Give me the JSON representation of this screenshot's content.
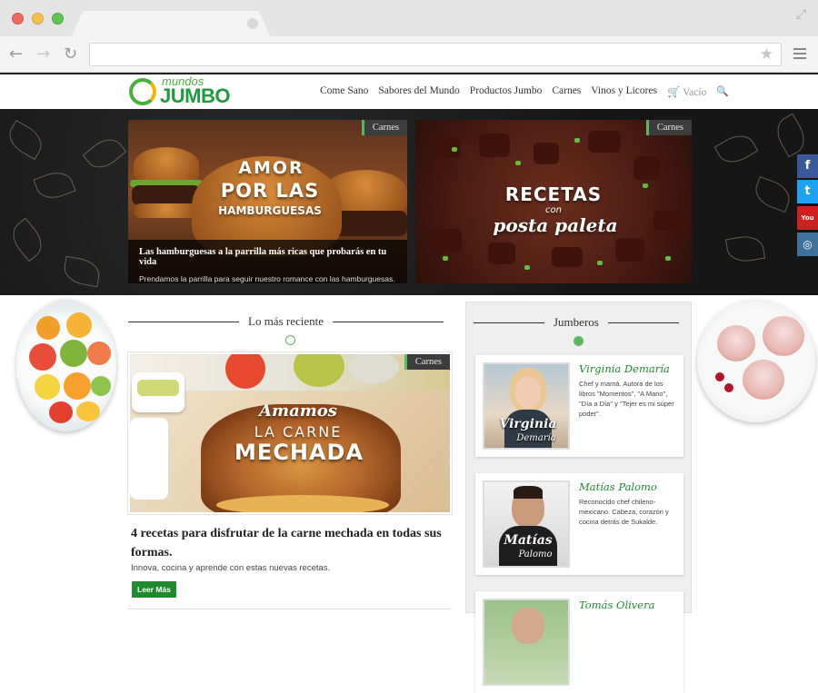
{
  "nav": {
    "items": [
      "Come Sano",
      "Sabores del Mundo",
      "Productos Jumbo",
      "Carnes",
      "Vinos y Licores"
    ],
    "cart": "Vacío"
  },
  "logo": {
    "top": "mundos",
    "bottom": "JUMBO"
  },
  "hero": {
    "cards": [
      {
        "tag": "Carnes",
        "image_text_1": "AMOR",
        "image_text_2": "POR LAS",
        "image_text_3": "HAMBURGUESAS",
        "title": "Las hamburguesas a la parrilla más ricas que probarás en tu vida",
        "subtitle": "Prendamos la parrilla para seguir nuestro romance con las hamburguesas."
      },
      {
        "tag": "Carnes",
        "image_text_1": "RECETAS",
        "image_text_2": "con",
        "image_text_3": "posta paleta"
      }
    ]
  },
  "social": {
    "facebook": "f",
    "twitter": "t",
    "youtube": "You Tube",
    "instagram": "◎"
  },
  "recent": {
    "heading": "Lo más reciente",
    "tag": "Carnes",
    "image_text_1": "Amamos",
    "image_text_2": "LA CARNE",
    "image_text_3": "MECHADA",
    "title": "4 recetas para disfrutar de la carne mechada en todas sus formas.",
    "subtitle": "Innova, cocina y aprende con estas nuevas recetas.",
    "button": "Leer Más"
  },
  "jumberos": {
    "heading": "Jumberos",
    "people": [
      {
        "name": "Virginia Demaría",
        "photo_caption_1": "Virginia",
        "photo_caption_2": "Demaría",
        "desc": "Chef y mamá. Autora de los libros \"Momentos\", \"A Mano\", \"Día a Día\" y \"Tejer es mi súper poder\"."
      },
      {
        "name": "Matías Palomo",
        "photo_caption_1": "Matías",
        "photo_caption_2": "Palomo",
        "desc": "Reconocido chef chileno-mexicano. Cabeza, corazón y cocina detrás de Sukalde."
      },
      {
        "name": "Tomás Olivera",
        "desc": ""
      }
    ]
  },
  "colors": {
    "brand_green": "#1f8a2e",
    "accent_green": "#5cb85c",
    "hero_dark": "#1a1a1a"
  }
}
